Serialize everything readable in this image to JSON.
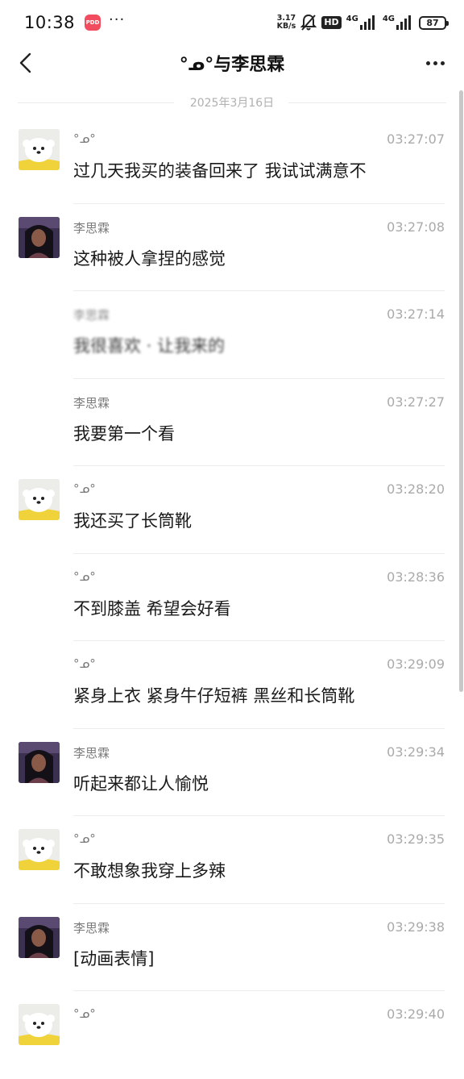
{
  "status_bar": {
    "time": "10:38",
    "app_badge": "PDD",
    "dots": "···",
    "net_speed_value": "3.17",
    "net_speed_unit": "KB/s",
    "hd_label": "HD",
    "signal_label_1": "4G",
    "signal_label_2": "4G",
    "battery_level": "87"
  },
  "header": {
    "title": "°ᓄ°与李思霖"
  },
  "date_divider": "2025年3月16日",
  "messages": [
    {
      "sender": "°ᓄ°",
      "time": "03:27:07",
      "text": "过几天我买的装备回来了 我试试满意不",
      "avatar": "dog"
    },
    {
      "sender": "李思霖",
      "time": "03:27:08",
      "text": "这种被人拿捏的感觉",
      "avatar": "girl"
    },
    {
      "sender": "李思霖",
      "time": "03:27:14",
      "text": "我很喜欢 · 让我来的",
      "avatar": "none"
    },
    {
      "sender": "李思霖",
      "time": "03:27:27",
      "text": "我要第一个看",
      "avatar": "none"
    },
    {
      "sender": "°ᓄ°",
      "time": "03:28:20",
      "text": "我还买了长筒靴",
      "avatar": "dog"
    },
    {
      "sender": "°ᓄ°",
      "time": "03:28:36",
      "text": "不到膝盖 希望会好看",
      "avatar": "none"
    },
    {
      "sender": "°ᓄ°",
      "time": "03:29:09",
      "text": "紧身上衣 紧身牛仔短裤 黑丝和长筒靴",
      "avatar": "none"
    },
    {
      "sender": "李思霖",
      "time": "03:29:34",
      "text": "听起来都让人愉悦",
      "avatar": "girl"
    },
    {
      "sender": "°ᓄ°",
      "time": "03:29:35",
      "text": "不敢想象我穿上多辣",
      "avatar": "dog"
    },
    {
      "sender": "李思霖",
      "time": "03:29:38",
      "text": "[动画表情]",
      "avatar": "girl"
    },
    {
      "sender": "°ᓄ°",
      "time": "03:29:40",
      "text": "",
      "avatar": "dog"
    }
  ]
}
